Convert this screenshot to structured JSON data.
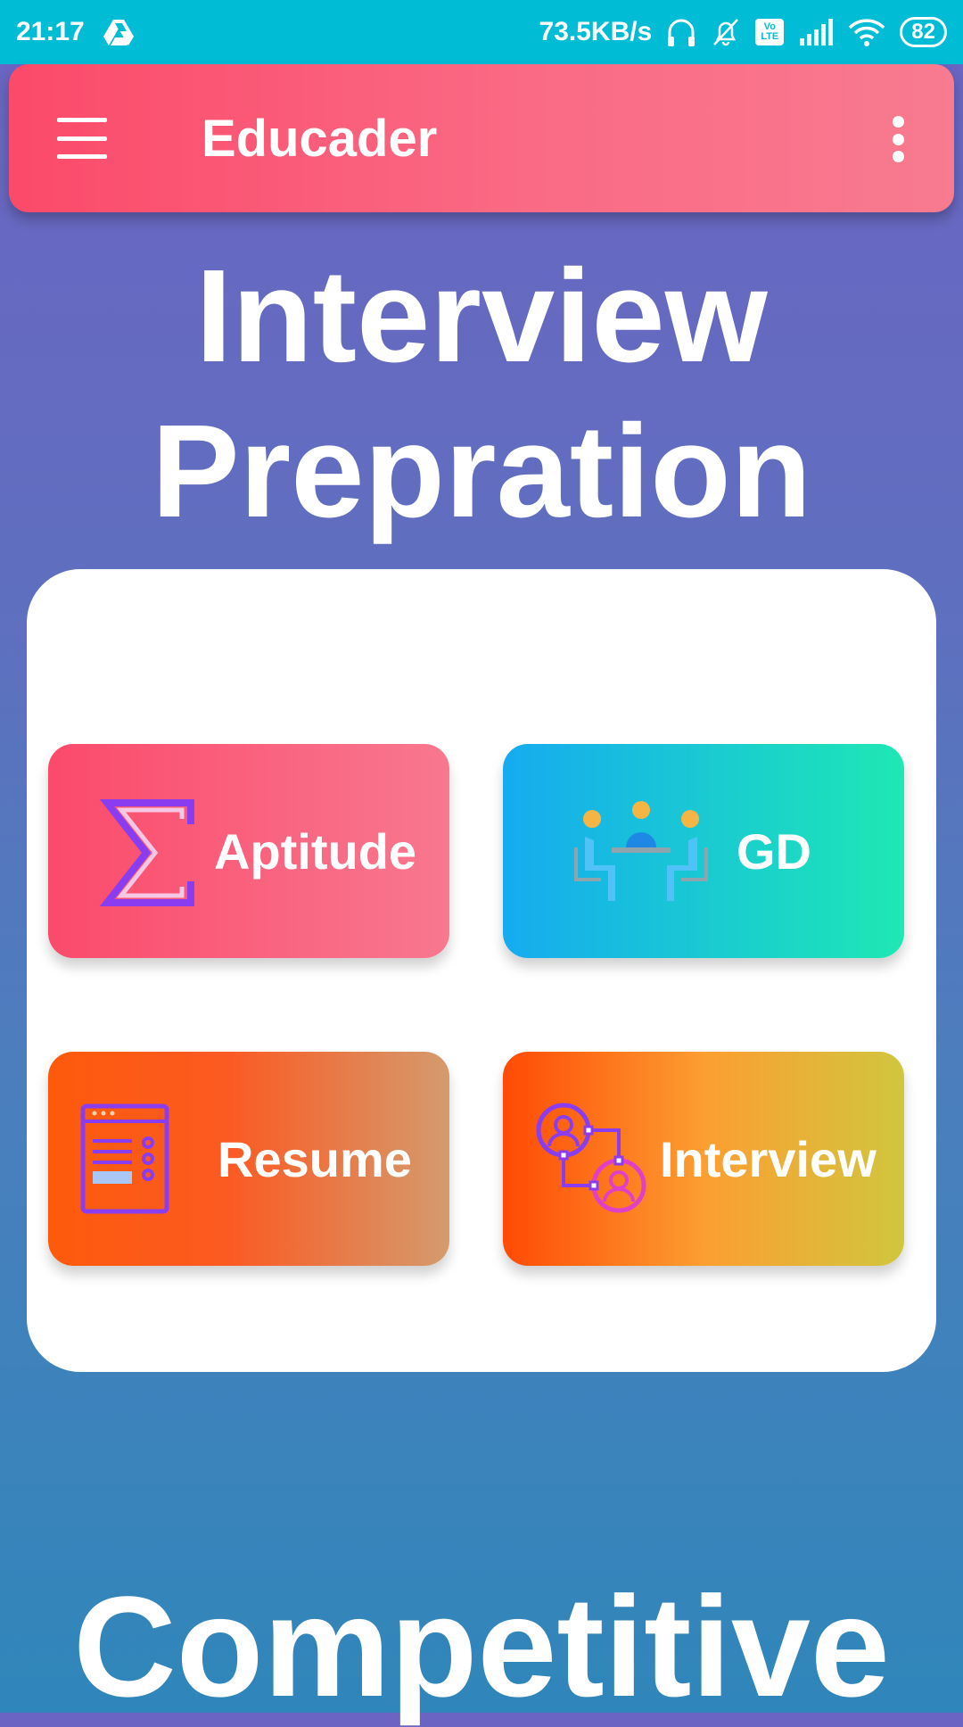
{
  "status_bar": {
    "time": "21:17",
    "network_speed": "73.5KB/s",
    "volte": "Vo LTE",
    "battery": "82",
    "icons": [
      "drive-icon",
      "headphones-icon",
      "bell-off-icon",
      "volte-icon",
      "signal-icon",
      "wifi-icon",
      "battery-icon"
    ]
  },
  "app_bar": {
    "title": "Educader",
    "menu_icon": "menu-icon",
    "more_icon": "more-vertical-icon",
    "color_start": "#fb4a6a",
    "color_end": "#f87b90"
  },
  "section_1": {
    "heading_line1": "Interview",
    "heading_line2": "Prepration",
    "tiles": [
      {
        "label": "Aptitude",
        "icon": "sigma-icon",
        "colors": [
          "#fb4a6b",
          "#f8788f"
        ]
      },
      {
        "label": "GD",
        "icon": "group-discussion-icon",
        "colors": [
          "#15abf0",
          "#1ee8b4"
        ]
      },
      {
        "label": "Resume",
        "icon": "resume-icon",
        "colors": [
          "#fe5a0c",
          "#d49b6e"
        ]
      },
      {
        "label": "Interview",
        "icon": "interview-icon",
        "colors": [
          "#ff4a05",
          "#d1c63e"
        ]
      }
    ]
  },
  "section_2": {
    "heading": "Competitive"
  },
  "theme": {
    "status_bar_color": "#00bcd4",
    "background_top": "#6c64c2",
    "background_bottom": "#2f86ba"
  }
}
